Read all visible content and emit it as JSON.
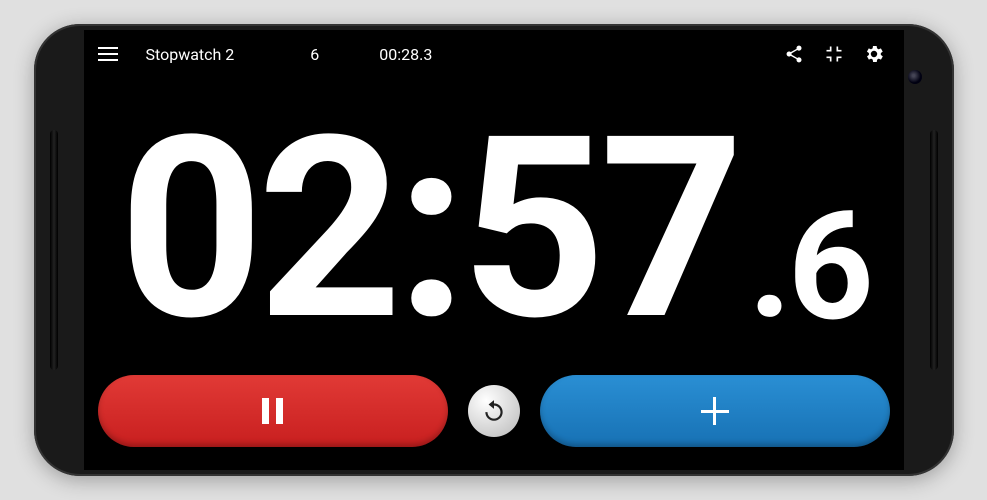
{
  "topbar": {
    "title": "Stopwatch 2",
    "lap_count": "6",
    "lap_time": "00:28.3"
  },
  "time": {
    "main": "02:57",
    "dot": ".",
    "tenths": "6"
  }
}
